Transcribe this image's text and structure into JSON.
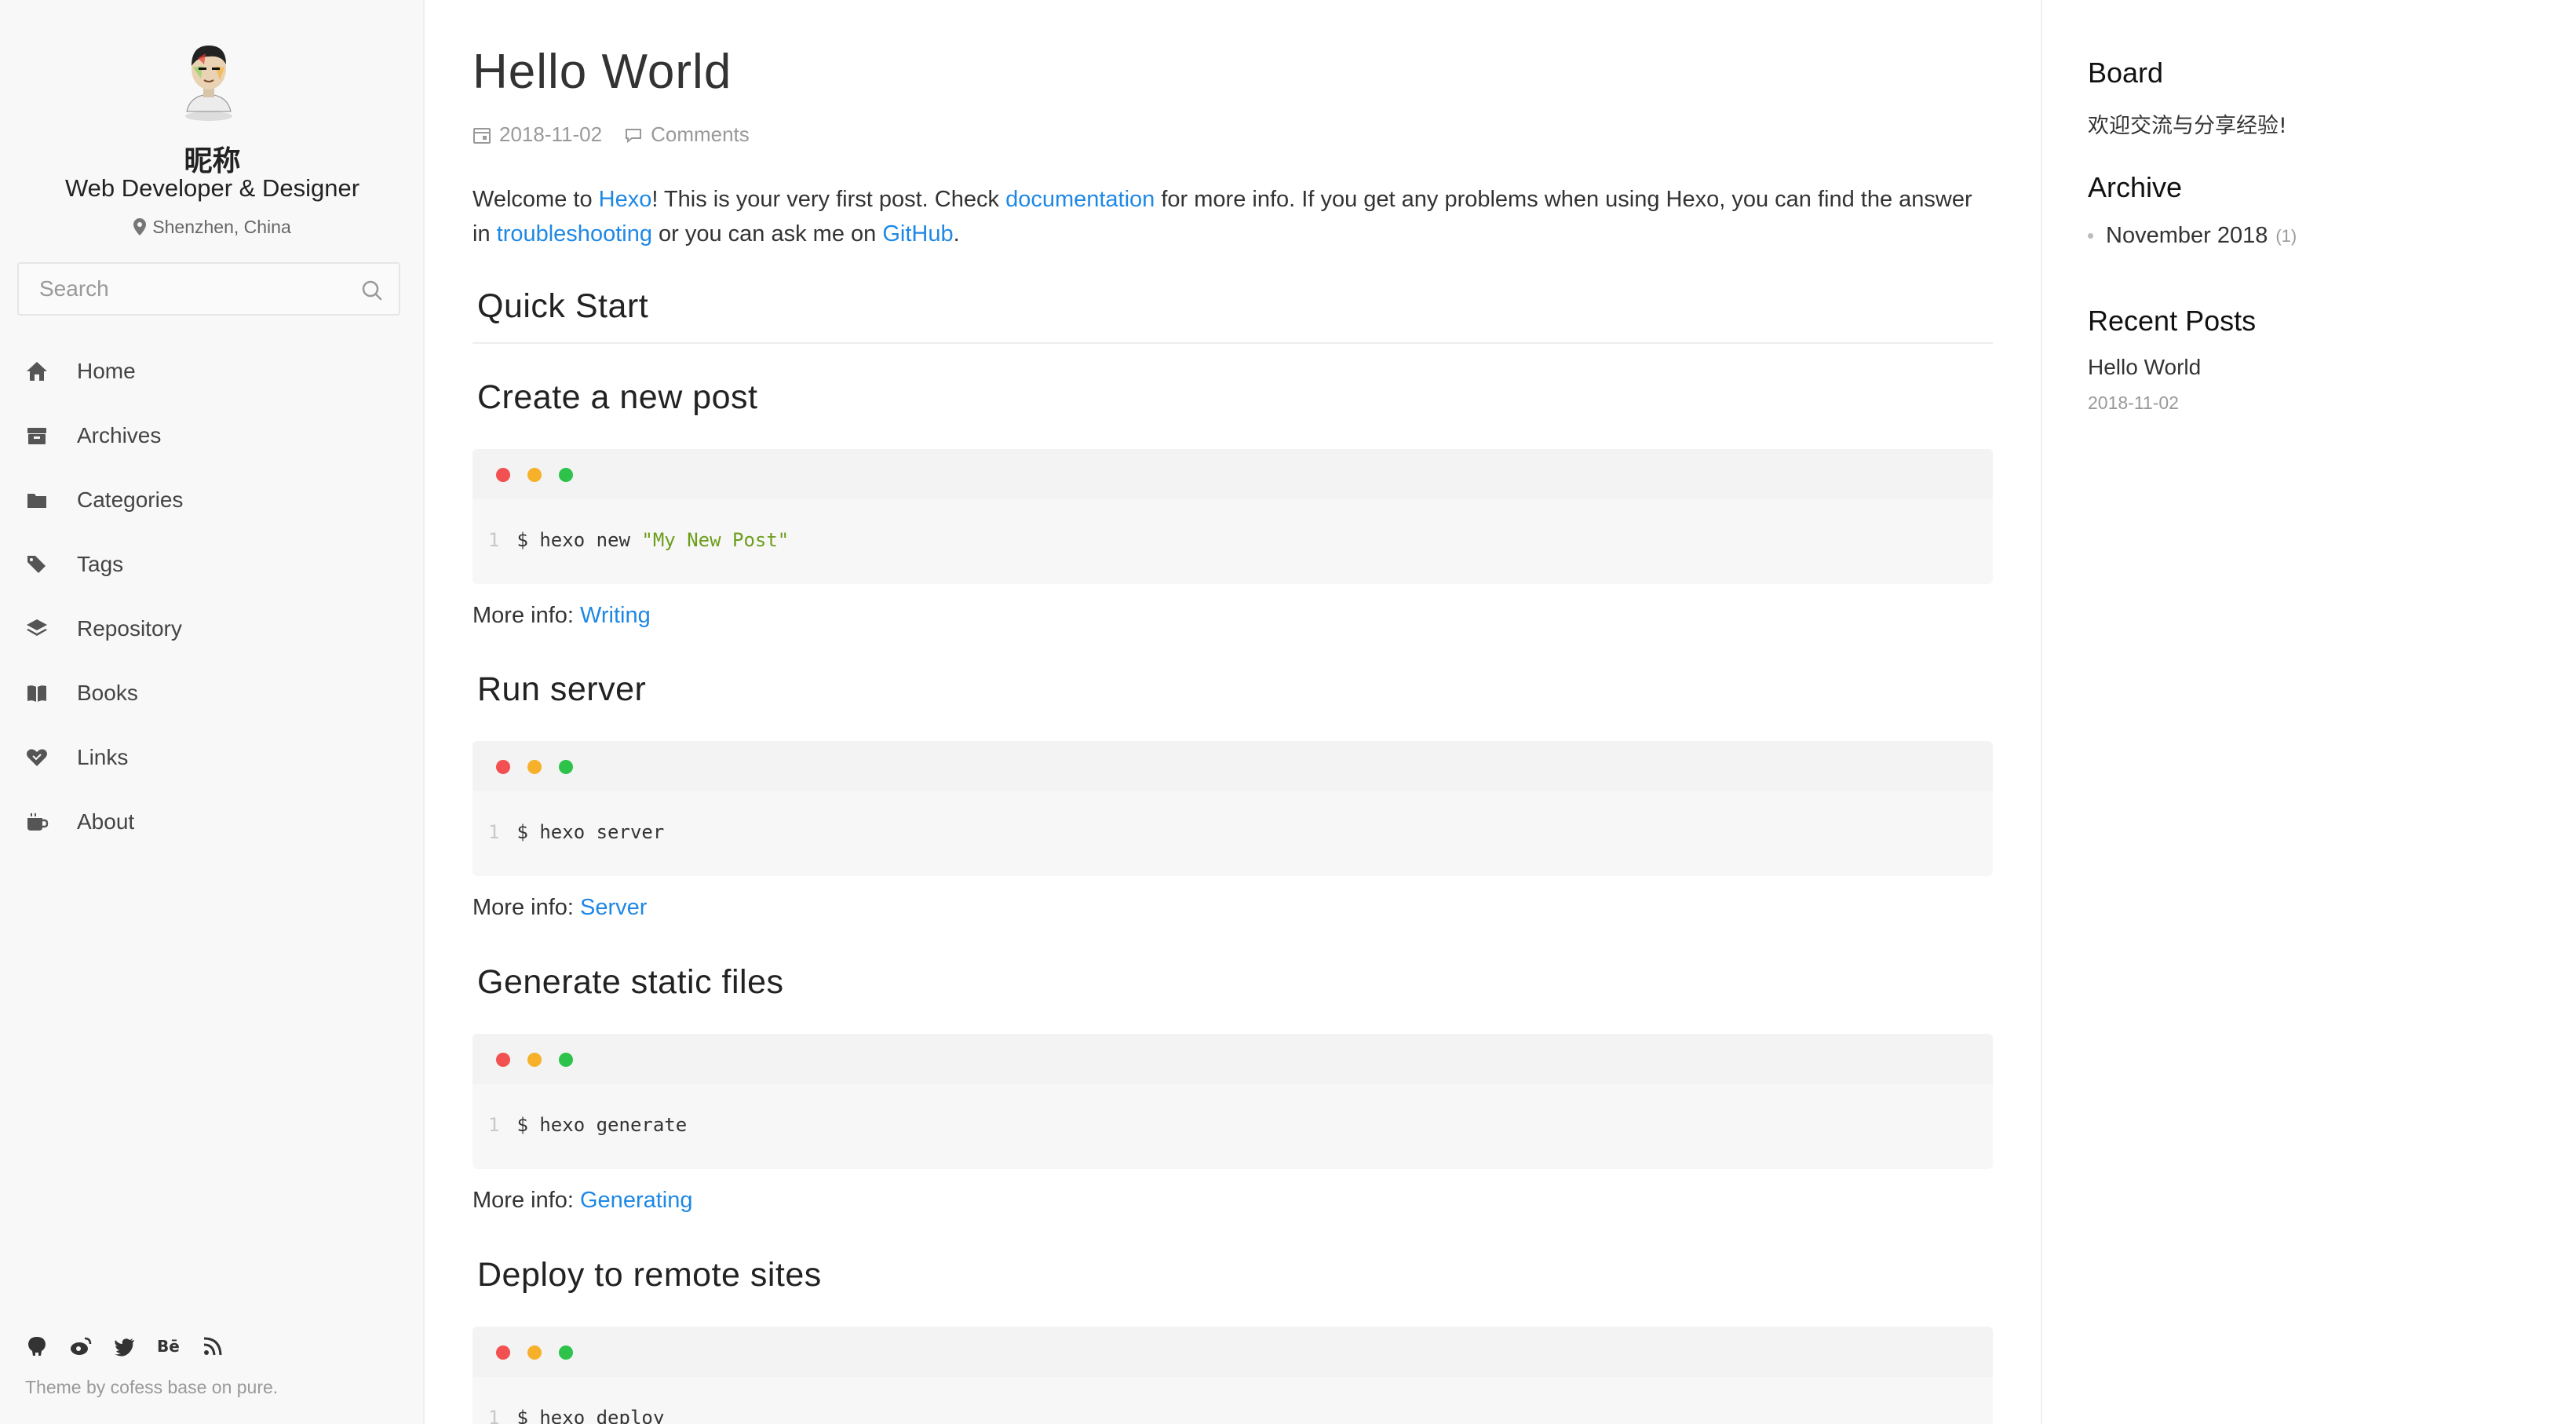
{
  "profile": {
    "nickname": "昵称",
    "title": "Web Developer & Designer",
    "location": "Shenzhen, China"
  },
  "search": {
    "placeholder": "Search"
  },
  "nav": [
    {
      "label": "Home",
      "icon": "home-icon"
    },
    {
      "label": "Archives",
      "icon": "archive-icon"
    },
    {
      "label": "Categories",
      "icon": "folder-icon"
    },
    {
      "label": "Tags",
      "icon": "tags-icon"
    },
    {
      "label": "Repository",
      "icon": "layers-icon"
    },
    {
      "label": "Books",
      "icon": "book-icon"
    },
    {
      "label": "Links",
      "icon": "heart-link-icon"
    },
    {
      "label": "About",
      "icon": "coffee-icon"
    }
  ],
  "social": [
    "github-icon",
    "weibo-icon",
    "twitter-icon",
    "behance-icon",
    "rss-icon"
  ],
  "footer": {
    "credit": "Theme by cofess base on pure."
  },
  "post": {
    "title": "Hello World",
    "date": "2018-11-02",
    "comments_label": "Comments",
    "lead": {
      "t1": "Welcome to ",
      "hexo": "Hexo",
      "t2": "! This is your very first post. Check ",
      "documentation": "documentation",
      "t3": " for more info. If you get any problems when using Hexo, you can find the answer in ",
      "troubleshooting": "troubleshooting",
      "t4": " or you can ask me on ",
      "github": "GitHub",
      "t5": "."
    },
    "quick_start": "Quick Start",
    "more_info_label": "More info: ",
    "sections": [
      {
        "heading": "Create a new post",
        "line_no": "1",
        "cmd": "$ hexo new ",
        "arg": "\"My New Post\"",
        "link": "Writing"
      },
      {
        "heading": "Run server",
        "line_no": "1",
        "cmd": "$ hexo server",
        "arg": "",
        "link": "Server"
      },
      {
        "heading": "Generate static files",
        "line_no": "1",
        "cmd": "$ hexo generate",
        "arg": "",
        "link": "Generating"
      },
      {
        "heading": "Deploy to remote sites",
        "line_no": "1",
        "cmd": "$ hexo deploy",
        "arg": "",
        "link": ""
      }
    ]
  },
  "aside": {
    "board_title": "Board",
    "board_text": "欢迎交流与分享经验!",
    "archive_title": "Archive",
    "archive_item": "November 2018",
    "archive_count": "(1)",
    "recent_title": "Recent Posts",
    "recent_post": "Hello World",
    "recent_date": "2018-11-02"
  },
  "colors": {
    "link": "#1e88e5",
    "dot_red": "#f35151",
    "dot_yellow": "#f6b02a",
    "dot_green": "#2dc34a",
    "string": "#6d9d1c"
  }
}
